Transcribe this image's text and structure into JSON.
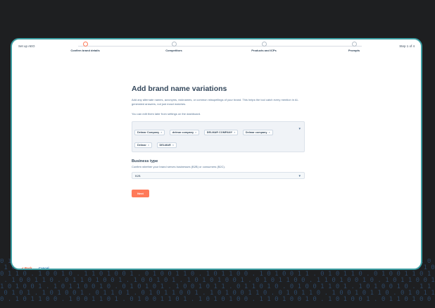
{
  "header": {
    "setup_label": "Set up AEO",
    "step_counter": "Step 1 of 4",
    "steps": [
      {
        "label": "Confirm brand details"
      },
      {
        "label": "Competitors"
      },
      {
        "label": "Products and ICPs"
      },
      {
        "label": "Prompts"
      }
    ]
  },
  "main": {
    "title": "Add brand name variations",
    "description": "Add any alternate names, acronyms, nicknames, or common misspellings of your brand. This helps the tool catch every mention in AI-generated answers, not just exact matches.",
    "edit_note": "You can edit them later from settings on the dashboard.",
    "tags": [
      {
        "label": "Delmar Company"
      },
      {
        "label": "delmar company"
      },
      {
        "label": "DELMAR COMPANY"
      },
      {
        "label": "Delmar company"
      },
      {
        "label": "Delmar"
      },
      {
        "label": "DELMAR"
      }
    ],
    "tag_remove": "×",
    "business_type": {
      "title": "Business type",
      "description": "Confirm whether your brand serves businesses (B2B) or consumers (B2C).",
      "value": "B2B"
    },
    "next_label": "Next"
  },
  "footer": {
    "back_label": "< Back",
    "cancel_label": "Cancel"
  },
  "colors": {
    "accent": "#ff7a59",
    "frame_border": "#3c9ea3",
    "text": "#33475b"
  }
}
